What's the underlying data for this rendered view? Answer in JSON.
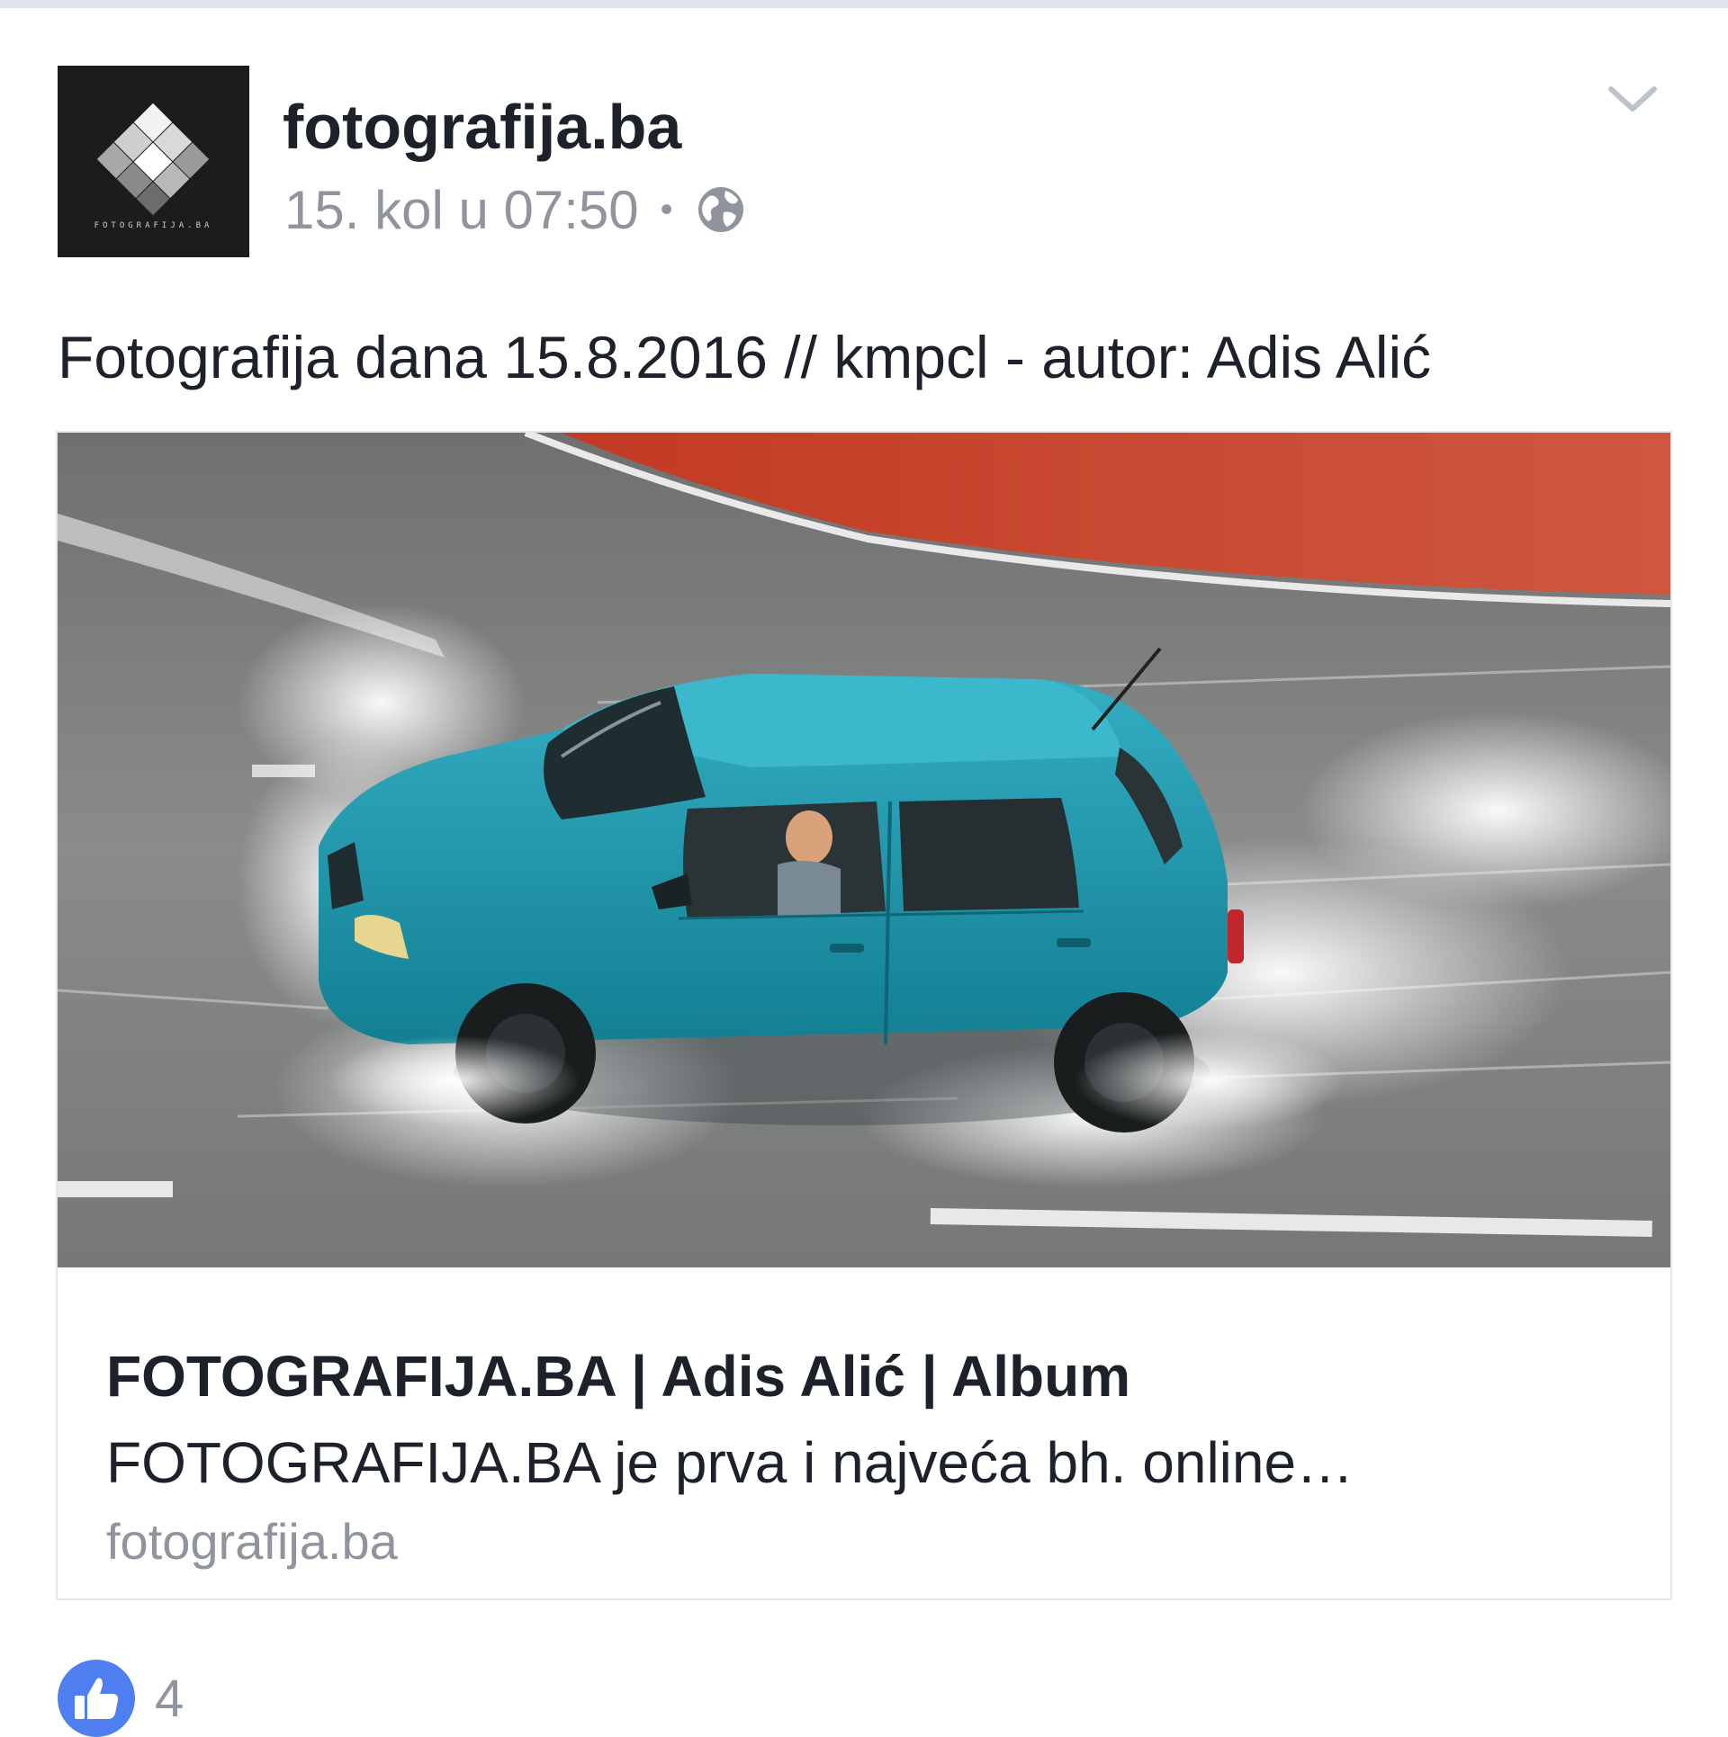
{
  "post": {
    "author": "fotografija.ba",
    "timestamp": "15. kol u 07:50",
    "separator": "•",
    "audience_icon": "globe-icon",
    "menu_icon": "chevron-down-icon",
    "avatar_caption": "FOTOGRAFIJA.BA",
    "text": "Fotografija dana 15.8.2016 // kmpcl - autor: Adis Alić"
  },
  "link_preview": {
    "image_description_icon": "photo",
    "title": "FOTOGRAFIJA.BA | Adis Alić | Album",
    "description": "FOTOGRAFIJA.BA je prva i najveća bh. online…",
    "domain": "fotografija.ba"
  },
  "reactions": {
    "icon": "like-icon",
    "count": "4"
  },
  "colors": {
    "text_primary": "#1d2129",
    "text_secondary": "#90949c",
    "like_blue": "#4267b2",
    "car_teal": "#1a98ae",
    "road_gray": "#8a8c8c",
    "red_lane": "#c7482f"
  }
}
